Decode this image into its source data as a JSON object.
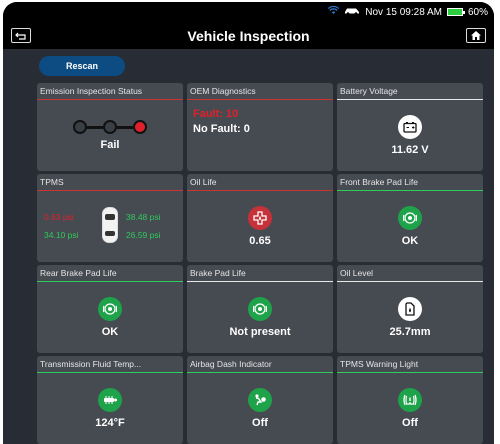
{
  "status_bar": {
    "time": "Nov 15 09:28 AM",
    "battery": "60%"
  },
  "title": "Vehicle Inspection",
  "rescan_label": "Rescan",
  "cards": {
    "emission": {
      "title": "Emission Inspection Status",
      "value": "Fail"
    },
    "oem": {
      "title": "OEM Diagnostics",
      "fault": "Fault: 10",
      "nofault": "No Fault: 0"
    },
    "battery": {
      "title": "Battery Voltage",
      "value": "11.62 V",
      "icon": "battery-icon"
    },
    "tpms": {
      "title": "TPMS",
      "fl": "0.63 psi",
      "fr": "38.48 psi",
      "rl": "34.10 psi",
      "rr": "26.59 psi"
    },
    "oil_life": {
      "title": "Oil Life",
      "value": "0.65",
      "icon": "oil-life-icon"
    },
    "front_brake": {
      "title": "Front Brake Pad Life",
      "value": "OK",
      "icon": "brake-icon"
    },
    "rear_brake": {
      "title": "Rear Brake Pad Life",
      "value": "OK",
      "icon": "brake-icon"
    },
    "brake_pad": {
      "title": "Brake Pad Life",
      "value": "Not present",
      "icon": "brake-icon"
    },
    "oil_level": {
      "title": "Oil Level",
      "value": "25.7mm",
      "icon": "oil-level-icon"
    },
    "trans_fluid": {
      "title": "Transmission Fluid Temp...",
      "value": "124°F",
      "icon": "transmission-icon"
    },
    "airbag": {
      "title": "Airbag Dash Indicator",
      "value": "Off",
      "icon": "airbag-icon"
    },
    "tpms_light": {
      "title": "TPMS Warning Light",
      "value": "Off",
      "icon": "tpms-warning-icon"
    }
  },
  "colors": {
    "bad": "#e0212b",
    "good": "#2ecc5b",
    "card": "#464a51",
    "accent": "#0d4c82"
  }
}
